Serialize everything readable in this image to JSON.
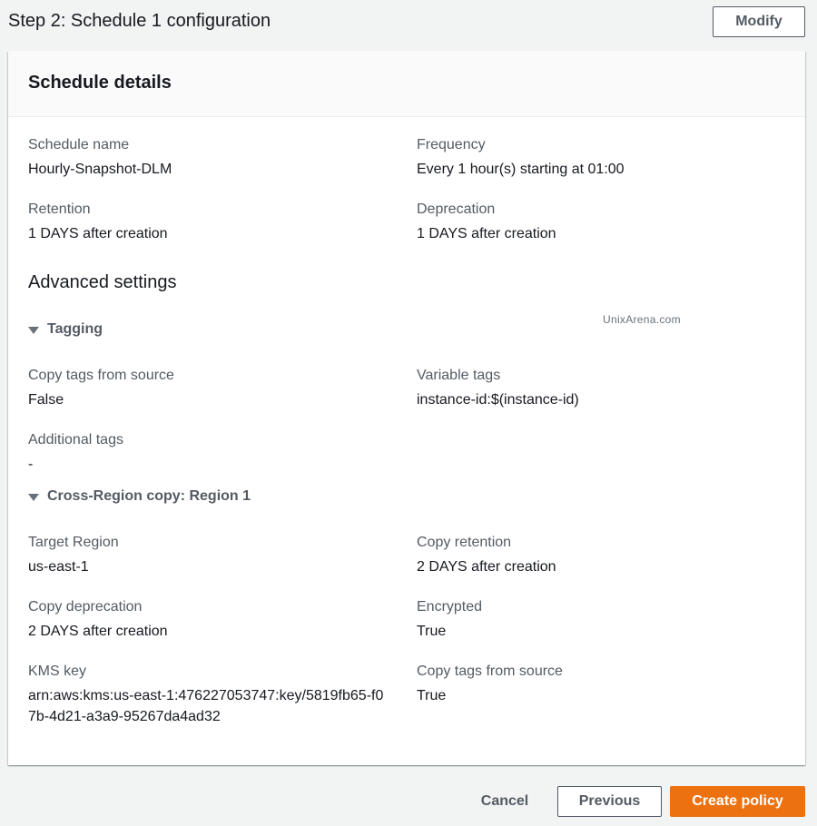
{
  "step": {
    "title": "Step 2: Schedule 1 configuration",
    "modify_label": "Modify"
  },
  "panel": {
    "title": "Schedule details",
    "schedule_name": {
      "label": "Schedule name",
      "value": "Hourly-Snapshot-DLM"
    },
    "frequency": {
      "label": "Frequency",
      "value": "Every 1 hour(s) starting at 01:00"
    },
    "retention": {
      "label": "Retention",
      "value": "1 DAYS after creation"
    },
    "deprecation": {
      "label": "Deprecation",
      "value": "1 DAYS after creation"
    }
  },
  "advanced": {
    "title": "Advanced settings",
    "watermark": "UnixArena.com",
    "tagging": {
      "label": "Tagging",
      "copy_tags": {
        "label": "Copy tags from source",
        "value": "False"
      },
      "variable_tags": {
        "label": "Variable tags",
        "value": "instance-id:$(instance-id)"
      },
      "additional_tags": {
        "label": "Additional tags",
        "value": "-"
      }
    },
    "cross_region": {
      "label": "Cross-Region copy: Region 1",
      "target_region": {
        "label": "Target Region",
        "value": "us-east-1"
      },
      "copy_retention": {
        "label": "Copy retention",
        "value": "2 DAYS after creation"
      },
      "copy_deprecation": {
        "label": "Copy deprecation",
        "value": "2 DAYS after creation"
      },
      "encrypted": {
        "label": "Encrypted",
        "value": "True"
      },
      "kms_key": {
        "label": "KMS key",
        "value": "arn:aws:kms:us-east-1:476227053747:key/5819fb65-f07b-4d21-a3a9-95267da4ad32"
      },
      "copy_tags": {
        "label": "Copy tags from source",
        "value": "True"
      }
    }
  },
  "footer": {
    "cancel_label": "Cancel",
    "previous_label": "Previous",
    "create_label": "Create policy"
  },
  "colors": {
    "primary_button": "#ec7211",
    "page_background": "#f2f3f3",
    "text": "#16191f",
    "label_text": "#545b64"
  },
  "icons": {
    "expander": "caret-down-icon"
  }
}
